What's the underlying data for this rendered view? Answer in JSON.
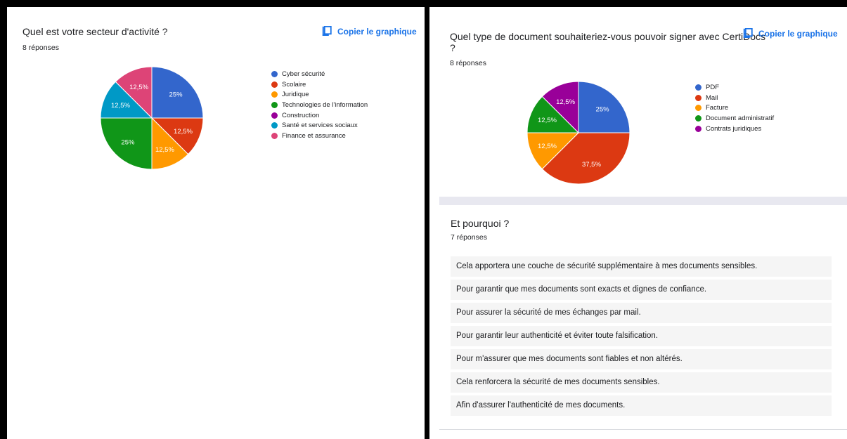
{
  "left": {
    "title": "Quel est votre secteur d'activité ?",
    "count": "8 réponses",
    "copy_label": "Copier le graphique"
  },
  "right": {
    "title_line1": "Quel type de document souhaiteriez-vous pouvoir signer avec CertiDocs",
    "title_line2": "?",
    "count": "8 réponses",
    "copy_label": "Copier le graphique",
    "followup": {
      "title": "Et pourquoi ?",
      "count": "7 réponses",
      "responses": [
        "Cela apportera une couche de sécurité supplémentaire à mes documents sensibles.",
        "Pour garantir que mes documents sont exacts et dignes de confiance.",
        "Pour assurer la sécurité de mes échanges par mail.",
        "Pour garantir leur authenticité et éviter toute falsification.",
        "Pour m'assurer que mes documents sont fiables et non altérés.",
        "Cela renforcera la sécurité de mes documents sensibles.",
        "Afin d'assurer l'authenticité de mes documents."
      ]
    }
  },
  "chart_data": [
    {
      "type": "pie",
      "title": "Quel est votre secteur d'activité ?",
      "categories": [
        "Cyber sécurité",
        "Scolaire",
        "Juridique",
        "Technologies de l'information",
        "Construction",
        "Santé et services sociaux",
        "Finance et assurance"
      ],
      "colors": [
        "#3366cc",
        "#dc3912",
        "#ff9900",
        "#109618",
        "#990099",
        "#0099c6",
        "#dd4477"
      ],
      "slices": [
        {
          "label": "Cyber sécurité",
          "value": 25,
          "text": "25%"
        },
        {
          "label": "Scolaire",
          "value": 12.5,
          "text": "12,5%"
        },
        {
          "label": "Juridique",
          "value": 12.5,
          "text": "12,5%"
        },
        {
          "label": "Technologies de l'information",
          "value": 25,
          "text": "25%"
        },
        {
          "label": "Santé et services sociaux",
          "value": 12.5,
          "text": "12,5%"
        },
        {
          "label": "Finance et assurance",
          "value": 12.5,
          "text": "12,5%"
        }
      ],
      "legend_position": "right"
    },
    {
      "type": "pie",
      "title": "Quel type de document souhaiteriez-vous pouvoir signer avec CertiDocs ?",
      "categories": [
        "PDF",
        "Mail",
        "Facture",
        "Document administratif",
        "Contrats juridiques"
      ],
      "colors": [
        "#3366cc",
        "#dc3912",
        "#ff9900",
        "#109618",
        "#990099"
      ],
      "slices": [
        {
          "label": "PDF",
          "value": 25,
          "text": "25%"
        },
        {
          "label": "Mail",
          "value": 37.5,
          "text": "37,5%"
        },
        {
          "label": "Facture",
          "value": 12.5,
          "text": "12,5%"
        },
        {
          "label": "Document administratif",
          "value": 12.5,
          "text": "12,5%"
        },
        {
          "label": "Contrats juridiques",
          "value": 12.5,
          "text": "12,5%"
        }
      ],
      "legend_position": "right"
    }
  ]
}
